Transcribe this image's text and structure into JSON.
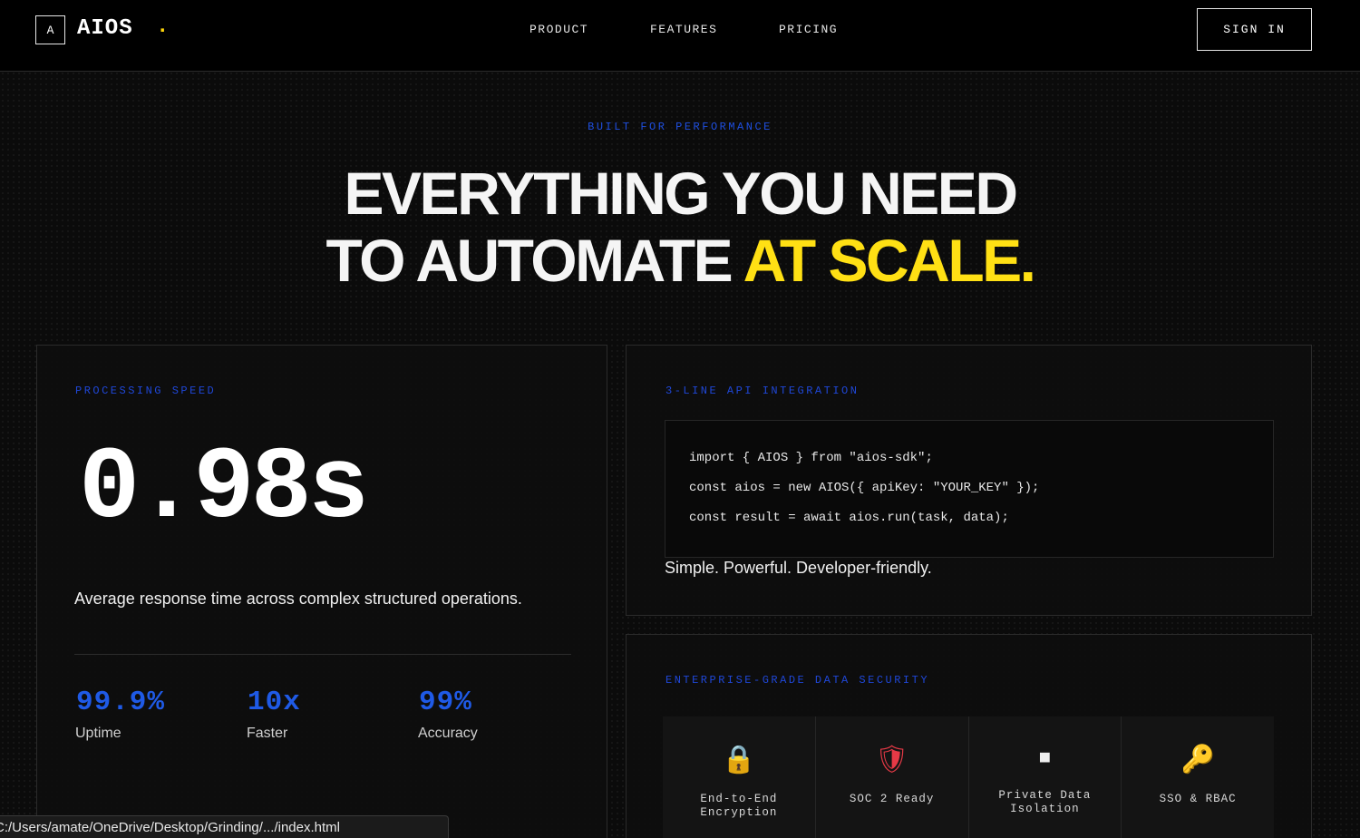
{
  "nav": {
    "logo_mark": "A",
    "logo_text": "AIOS",
    "logo_dot": ".",
    "links": [
      "PRODUCT",
      "FEATURES",
      "PRICING"
    ],
    "sign_in": "SIGN IN"
  },
  "hero": {
    "eyebrow": "BUILT FOR PERFORMANCE",
    "headline_line1": "EVERYTHING YOU NEED",
    "headline_line2_plain": "TO AUTOMATE ",
    "headline_line2_accent": "AT SCALE."
  },
  "speed_card": {
    "label": "PROCESSING SPEED",
    "value": "0.98s",
    "description": "Average response time across complex structured operations.",
    "stats": [
      {
        "value": "99.9%",
        "label": "Uptime"
      },
      {
        "value": "10x",
        "label": "Faster"
      },
      {
        "value": "99%",
        "label": "Accuracy"
      }
    ]
  },
  "api_card": {
    "label": "3-LINE API INTEGRATION",
    "code": [
      "import { AIOS } from \"aios-sdk\";",
      "const aios = new AIOS({ apiKey: \"YOUR_KEY\" });",
      "const result = await aios.run(task, data);"
    ],
    "tagline": "Simple. Powerful. Developer-friendly."
  },
  "security_card": {
    "label": "ENTERPRISE-GRADE DATA SECURITY",
    "items": [
      {
        "icon": "lock-icon",
        "glyph": "🔒",
        "label_line1": "End-to-End",
        "label_line2": "Encryption"
      },
      {
        "icon": "shield-icon",
        "glyph": "🛡",
        "label_line1": "SOC 2 Ready",
        "label_line2": ""
      },
      {
        "icon": "stop-square-icon",
        "glyph": "⏹",
        "label_line1": "Private Data",
        "label_line2": "Isolation"
      },
      {
        "icon": "key-icon",
        "glyph": "🔑",
        "label_line1": "SSO & RBAC",
        "label_line2": ""
      }
    ]
  },
  "status_bar": {
    "url": "C:/Users/amate/OneDrive/Desktop/Grinding/.../index.html"
  }
}
